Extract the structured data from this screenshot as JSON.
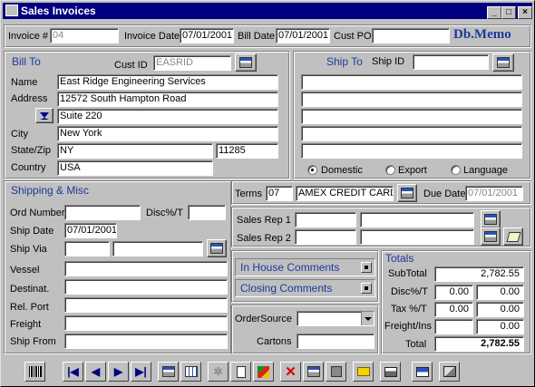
{
  "window": {
    "title": "Sales Invoices"
  },
  "header": {
    "invoice_label": "Invoice #",
    "invoice_value": "04",
    "invoice_date_label": "Invoice Date",
    "invoice_date_value": "07/01/2001",
    "bill_date_label": "Bill Date",
    "bill_date_value": "07/01/2001",
    "cust_po_label": "Cust PO",
    "cust_po_value": "",
    "brand": "Db.Memo"
  },
  "bill_to": {
    "heading": "Bill To",
    "cust_id_label": "Cust ID",
    "cust_id_value": "EASRID",
    "name_label": "Name",
    "name_value": "East Ridge Engineering Services",
    "address_label": "Address",
    "address1": "12572 South Hampton Road",
    "address2": "Suite 220",
    "city_label": "City",
    "city_value": "New York",
    "state_zip_label": "State/Zip",
    "state_value": "NY",
    "zip_value": "11285",
    "country_label": "Country",
    "country_value": "USA"
  },
  "ship_to": {
    "heading": "Ship To",
    "ship_id_label": "Ship ID",
    "ship_id_value": "",
    "options": [
      "Domestic",
      "Export",
      "Language"
    ],
    "selected": "Domestic"
  },
  "shipping": {
    "heading": "Shipping  & Misc",
    "ord_number_label": "Ord Number",
    "ord_number_value": "",
    "disc_label": "Disc%/T",
    "disc_value": "",
    "ship_date_label": "Ship Date",
    "ship_date_value": "07/01/2001",
    "ship_via_label": "Ship Via",
    "ship_via_code": "",
    "ship_via_name": "",
    "vessel_label": "Vessel",
    "destinat_label": "Destinat.",
    "rel_port_label": "Rel. Port",
    "freight_label": "Freight",
    "ship_from_label": "Ship From"
  },
  "terms": {
    "terms_label": "Terms",
    "terms_code": "07",
    "terms_name": "AMEX CREDIT CARD",
    "due_date_label": "Due Date",
    "due_date_value": "07/01/2001"
  },
  "reps": {
    "rep1_label": "Sales Rep 1",
    "rep2_label": "Sales Rep 2"
  },
  "comments": {
    "in_house": "In House Comments",
    "closing": "Closing Comments"
  },
  "order": {
    "order_source_label": "OrderSource",
    "cartons_label": "Cartons"
  },
  "totals": {
    "heading": "Totals",
    "subtotal_label": "SubTotal",
    "subtotal_value": "2,782.55",
    "disc_label": "Disc%/T",
    "disc_pct": "0.00",
    "disc_value": "0.00",
    "tax_label": "Tax %/T",
    "tax_pct": "0.00",
    "tax_value": "0.00",
    "freight_label": "Freight/Ins",
    "freight_value": "0.00",
    "total_label": "Total",
    "total_value": "2,782.55"
  },
  "colors": {
    "title_bar": "#000080",
    "label_blue": "#1c3a9c",
    "face": "#c0c0c0"
  }
}
